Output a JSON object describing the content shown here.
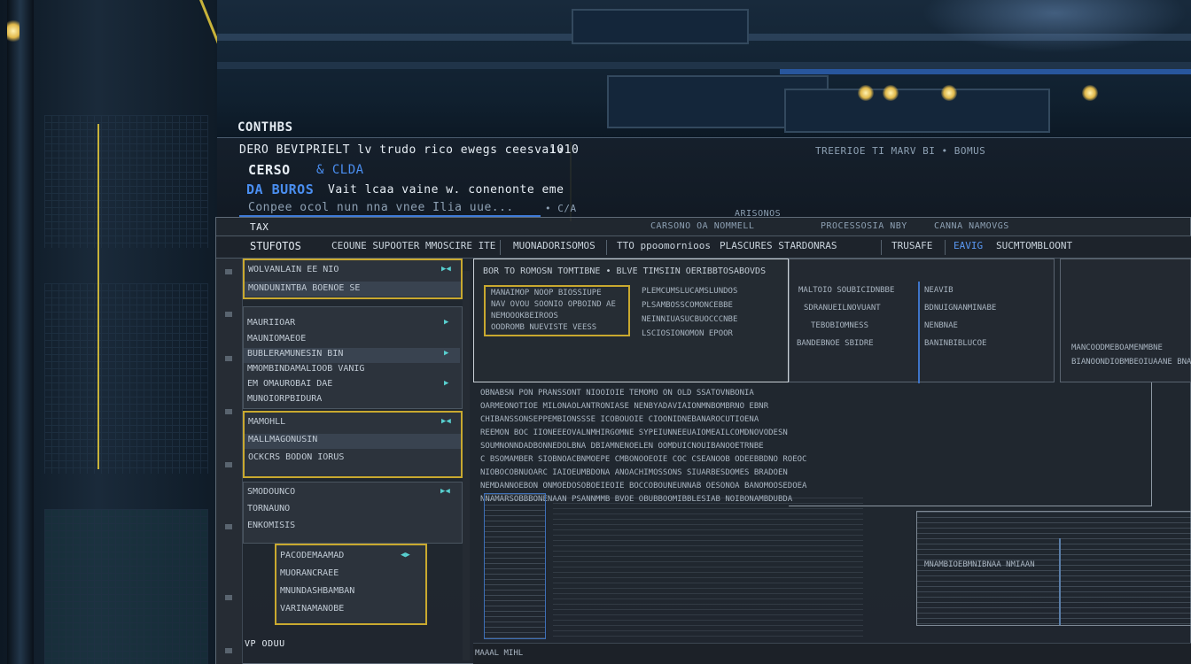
{
  "top_overlay": {
    "heading": "CONTHBS",
    "line1": "DERO BEVIPRIELT lv trudo rico ewegs ceesvaiv",
    "line1_num": "1010",
    "line1_right": "TREERIOE TI MARV BI • BOMUS",
    "line2": "CERSO",
    "line2_accent": "& CLDA",
    "line3_label": "DA BUROS",
    "line3_text": "Vait lcaa vaine w. conenonte eme",
    "line4": "Conpee ocol nun nna vnee Ilia uue...",
    "line4_tag": "• C/A"
  },
  "window": {
    "title_left": "TAX",
    "title_mid1": "CARSONO OA NOMMELL",
    "title_mid2": "ARISONOS",
    "title_mid3": "PROCESSOSIA NBY",
    "title_right": "CANNA NAMOVGS",
    "tabs": [
      "STUFOTOS",
      "CEOUNE SUPOOTER MMOSCIRE ITE",
      "MUONADORISOMOS",
      "TTO ppoomornioos",
      "PLASCURES STARDONRAS",
      "TRUSAFE",
      "EAVIG",
      "SUCMTOMBLOONT"
    ]
  },
  "sidebar": {
    "groups": [
      {
        "rows": [
          "WOLVANLAIN EE NIO",
          "MONDUNINTBA BOENOE SE"
        ]
      },
      {
        "rows": [
          "MAURIIOAR",
          "MAUNIOMAEOE",
          "BUBLERAMUNESIN BIN",
          "MMOMBINDAMALIOOB VANIG",
          "EM OMAUROBAI DAE",
          "MUNOIORPBIDURA"
        ]
      },
      {
        "rows": [
          "MAMOHLL",
          "MALLMAGONUSIN",
          "OCKCRS BODON IORUS"
        ]
      },
      {
        "rows": [
          "SMODOUNCO",
          "TORNAUNO",
          "ENKOMISIS"
        ]
      },
      {
        "rows": [
          "PACODEMAAMAD",
          "MUORANCRAEE",
          "MNUNDASHBAMBAN",
          "VARINAMANOBE"
        ]
      }
    ],
    "footer": "VP ODUU"
  },
  "content": {
    "box_title": "BOR TO ROMOSN TOMTIBNE • BLVE TIMSIIN OERIBBTOSABOVDS",
    "inner_lines": [
      "MANAIMOP NOOP BIOSSIUPE",
      "NAV OVOU SOONIO OPBOIND AE",
      "NEMOOOKBEIROOS",
      "OODROMB NUEVISTE VEESS"
    ],
    "side_lines": [
      "PLEMCUMSLUCAMSLUNDOS",
      "PLSAMBOSSCOMONCEBBE",
      "NEINNIUASUCBUOCCCNBE",
      "LSCIOSIONOMON EPOOR"
    ],
    "col2": [
      "MALTOIO SOUBICIDNBBE",
      "SDRANUEILNOVUANT",
      "TEBOBIOMNESS",
      "BANDEBNOE SBIDRE"
    ],
    "col3": [
      "NEAVIB",
      "BDNUIGNANMINABE",
      "NENBNAE",
      "BANINBIBLUCOE"
    ],
    "para": [
      "OBNABSN PON PRANSSONT NIOOIOIE TEMOMO ON OLD SSATOVNBONIA",
      "OARMEONOTIOE MILONAOLANTRONIASE NENBYADAVIAIONMNBOMBRNO EBNR",
      "CHIBANSSONSEPPEMBIONSSSE ICOBOUOIE CIOONIDNEBANAROCUTIOENA",
      "REEMON BOC IIONEEEOVALNMHIRGOMNE SYPEIUNNEEUAIOMEAILCOMDNOVODESN",
      "SOUMNONNDADBONNEDOLBNA DBIAMNENOELEN OOMDUICNOUIBANOOETRNBE",
      "C BSOMAMBER SIOBNOACBNMOEPE CMBONOOEOIE COC CSEANOOB ODEEBBDNO ROEOC",
      "NIOBOCOBNUOARC IAIOEUMBDONA ANOACHIMOSSONS SIUARBESDOMES BRADOEN",
      "NEMDANNOEBON ONMOEDOSOBOEIEOIE BOCCOBOUNEUNNAB OESONOA BANOMOOSEDOEA",
      "NNAMARSOBBBONENAAN PSANNMMB BVOE OBUBBOOMIBBLESIAB NOIBONAMBDUBDA"
    ],
    "right_box_lines": [
      "MANCOODMEBOAMENMBNE",
      "BIANOONDIOBMBEOIUAANE BNAME"
    ],
    "bottom_right_label": "MNAMBIOEBMNIBNAA NMIAAN",
    "footer_label": "MAAAL MIHL"
  },
  "colors": {
    "accent_yellow": "#c9a92f",
    "accent_blue": "#3e7ad8",
    "panel_bg": "#22282f"
  }
}
